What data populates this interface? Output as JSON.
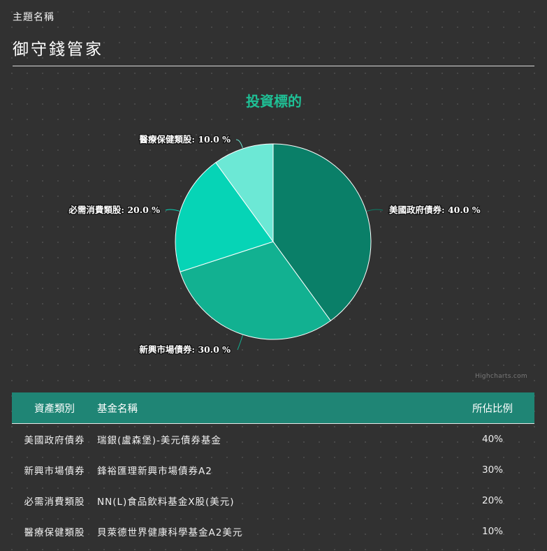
{
  "header": {
    "label": "主題名稱",
    "name": "御守錢管家"
  },
  "credit": "Highcharts.com",
  "colors": {
    "accent": "#1fbf95",
    "table_header": "#1f8575"
  },
  "chart_data": {
    "type": "pie",
    "title": "投資標的",
    "slices": [
      {
        "label": "美國政府債券",
        "value": 40.0,
        "display": "40.0 %",
        "color": "#0a7f68"
      },
      {
        "label": "新興市場債券",
        "value": 30.0,
        "display": "30.0 %",
        "color": "#12b191"
      },
      {
        "label": "必需消費類股",
        "value": 20.0,
        "display": "20.0 %",
        "color": "#06d4b6"
      },
      {
        "label": "醫療保健類股",
        "value": 10.0,
        "display": "10.0 %",
        "color": "#6ce8d5"
      }
    ]
  },
  "table": {
    "headers": [
      "資產類別",
      "基金名稱",
      "所佔比例"
    ],
    "rows": [
      {
        "category": "美國政府債券",
        "fund": "瑞銀(盧森堡)-美元債券基金",
        "percent": "40%"
      },
      {
        "category": "新興市場債券",
        "fund": "鋒裕匯理新興市場債券A2",
        "percent": "30%"
      },
      {
        "category": "必需消費類股",
        "fund": "NN(L)食品飲料基金X股(美元)",
        "percent": "20%"
      },
      {
        "category": "醫療保健類股",
        "fund": "貝萊德世界健康科學基金A2美元",
        "percent": "10%"
      }
    ]
  }
}
